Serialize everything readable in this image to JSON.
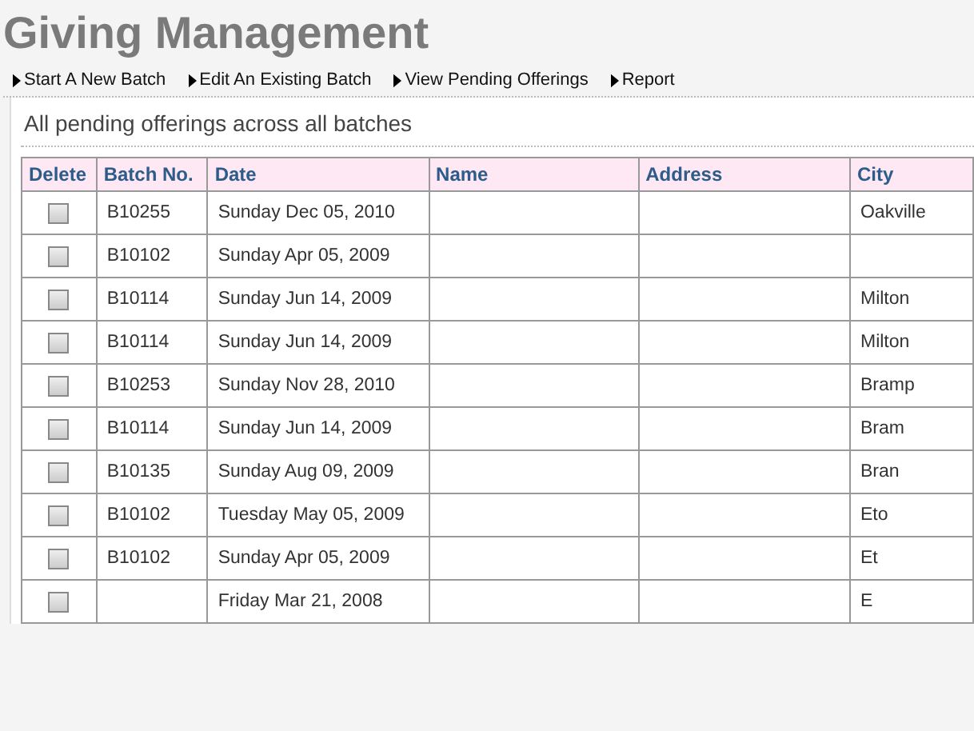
{
  "title": "Giving Management",
  "nav": [
    {
      "label": "Start A New Batch"
    },
    {
      "label": "Edit An Existing Batch"
    },
    {
      "label": "View Pending Offerings"
    },
    {
      "label": "Report"
    }
  ],
  "section_title": "All pending offerings across all batches",
  "table": {
    "columns": [
      "Delete",
      "Batch No.",
      "Date",
      "Name",
      "Address",
      "City"
    ],
    "rows": [
      {
        "checked": false,
        "batch": "B10255",
        "date": "Sunday Dec 05, 2010",
        "city": "Oakville"
      },
      {
        "checked": false,
        "batch": "B10102",
        "date": "Sunday Apr 05, 2009"
      },
      {
        "checked": false,
        "batch": "B10114",
        "date": "Sunday Jun 14, 2009",
        "city": "Milton"
      },
      {
        "checked": false,
        "batch": "B10114",
        "date": "Sunday Jun 14, 2009",
        "city": "Milton"
      },
      {
        "checked": false,
        "batch": "B10253",
        "date": "Sunday Nov 28, 2010",
        "city": "Bramp"
      },
      {
        "checked": false,
        "batch": "B10114",
        "date": "Sunday Jun 14, 2009",
        "city": "Bram"
      },
      {
        "checked": false,
        "batch": "B10135",
        "date": "Sunday Aug 09, 2009",
        "city": "Bran"
      },
      {
        "checked": false,
        "batch": "B10102",
        "date": "Tuesday May 05, 2009",
        "city": "Eto"
      },
      {
        "checked": false,
        "batch": "B10102",
        "date": "Sunday Apr 05, 2009",
        "city": "Et"
      },
      {
        "checked": false,
        "date": "Friday Mar 21, 2008",
        "city": "E"
      }
    ]
  }
}
